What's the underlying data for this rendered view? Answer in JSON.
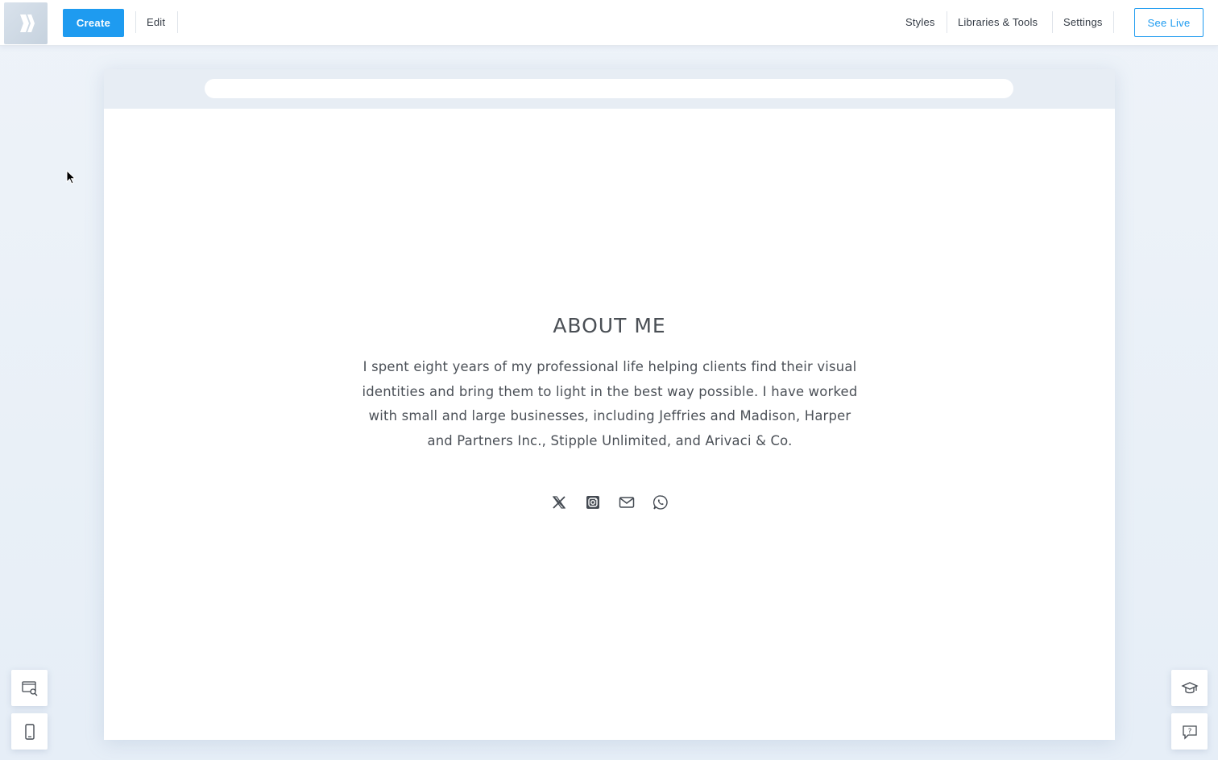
{
  "toolbar": {
    "logo_icon": "brand-logo-icon",
    "create_label": "Create",
    "edit_label": "Edit",
    "styles_label": "Styles",
    "libraries_label": "Libraries & Tools",
    "settings_label": "Settings",
    "see_live_label": "See Live",
    "accent_color": "#1e9bf0"
  },
  "page": {
    "about_title": "ABOUT ME",
    "about_text": "I spent eight years of my professional life helping clients find their visual identities and bring them to light in the best way possible. I have worked with small and large businesses, including Jeffries and Madison, Harper and Partners Inc., Stipple Unlimited, and Arivaci & Co.",
    "socials": [
      {
        "icon": "x-twitter-icon"
      },
      {
        "icon": "instagram-icon"
      },
      {
        "icon": "email-icon"
      },
      {
        "icon": "whatsapp-icon"
      }
    ]
  },
  "side_buttons": {
    "left": [
      {
        "icon": "seo-preview-icon"
      },
      {
        "icon": "mobile-view-icon"
      }
    ],
    "right": [
      {
        "icon": "academy-icon"
      },
      {
        "icon": "help-icon"
      }
    ]
  }
}
